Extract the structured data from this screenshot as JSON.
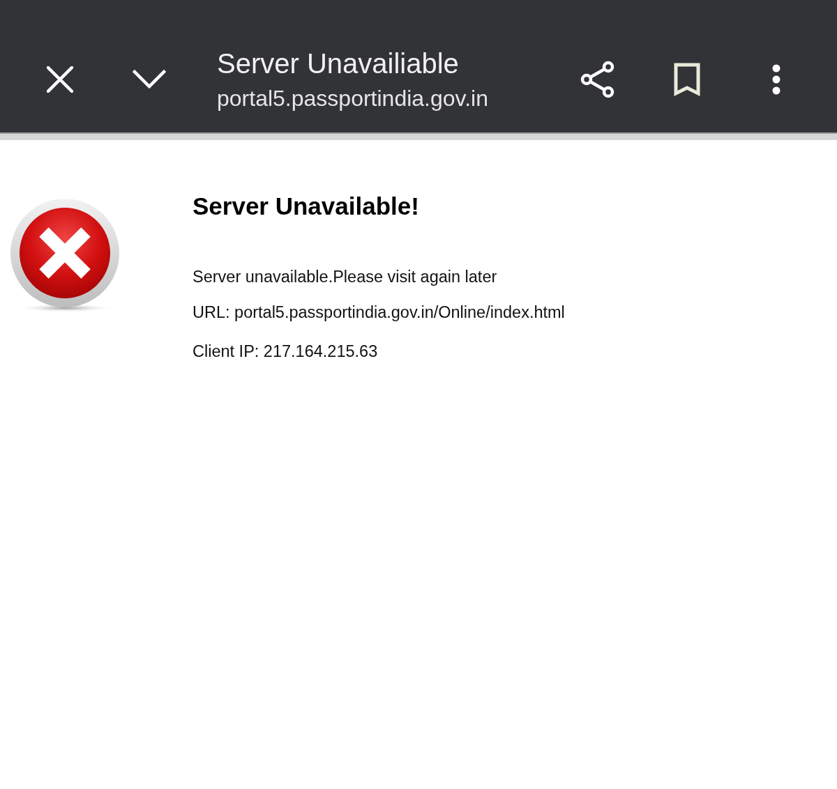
{
  "toolbar": {
    "title": "Server Unavailiable",
    "url": "portal5.passportindia.gov.in"
  },
  "page": {
    "heading": "Server Unavailable!",
    "lines": [
      "Server unavailable.Please visit again later",
      "URL: portal5.passportindia.gov.in/Online/index.html",
      "Client IP: 217.164.215.63"
    ]
  }
}
